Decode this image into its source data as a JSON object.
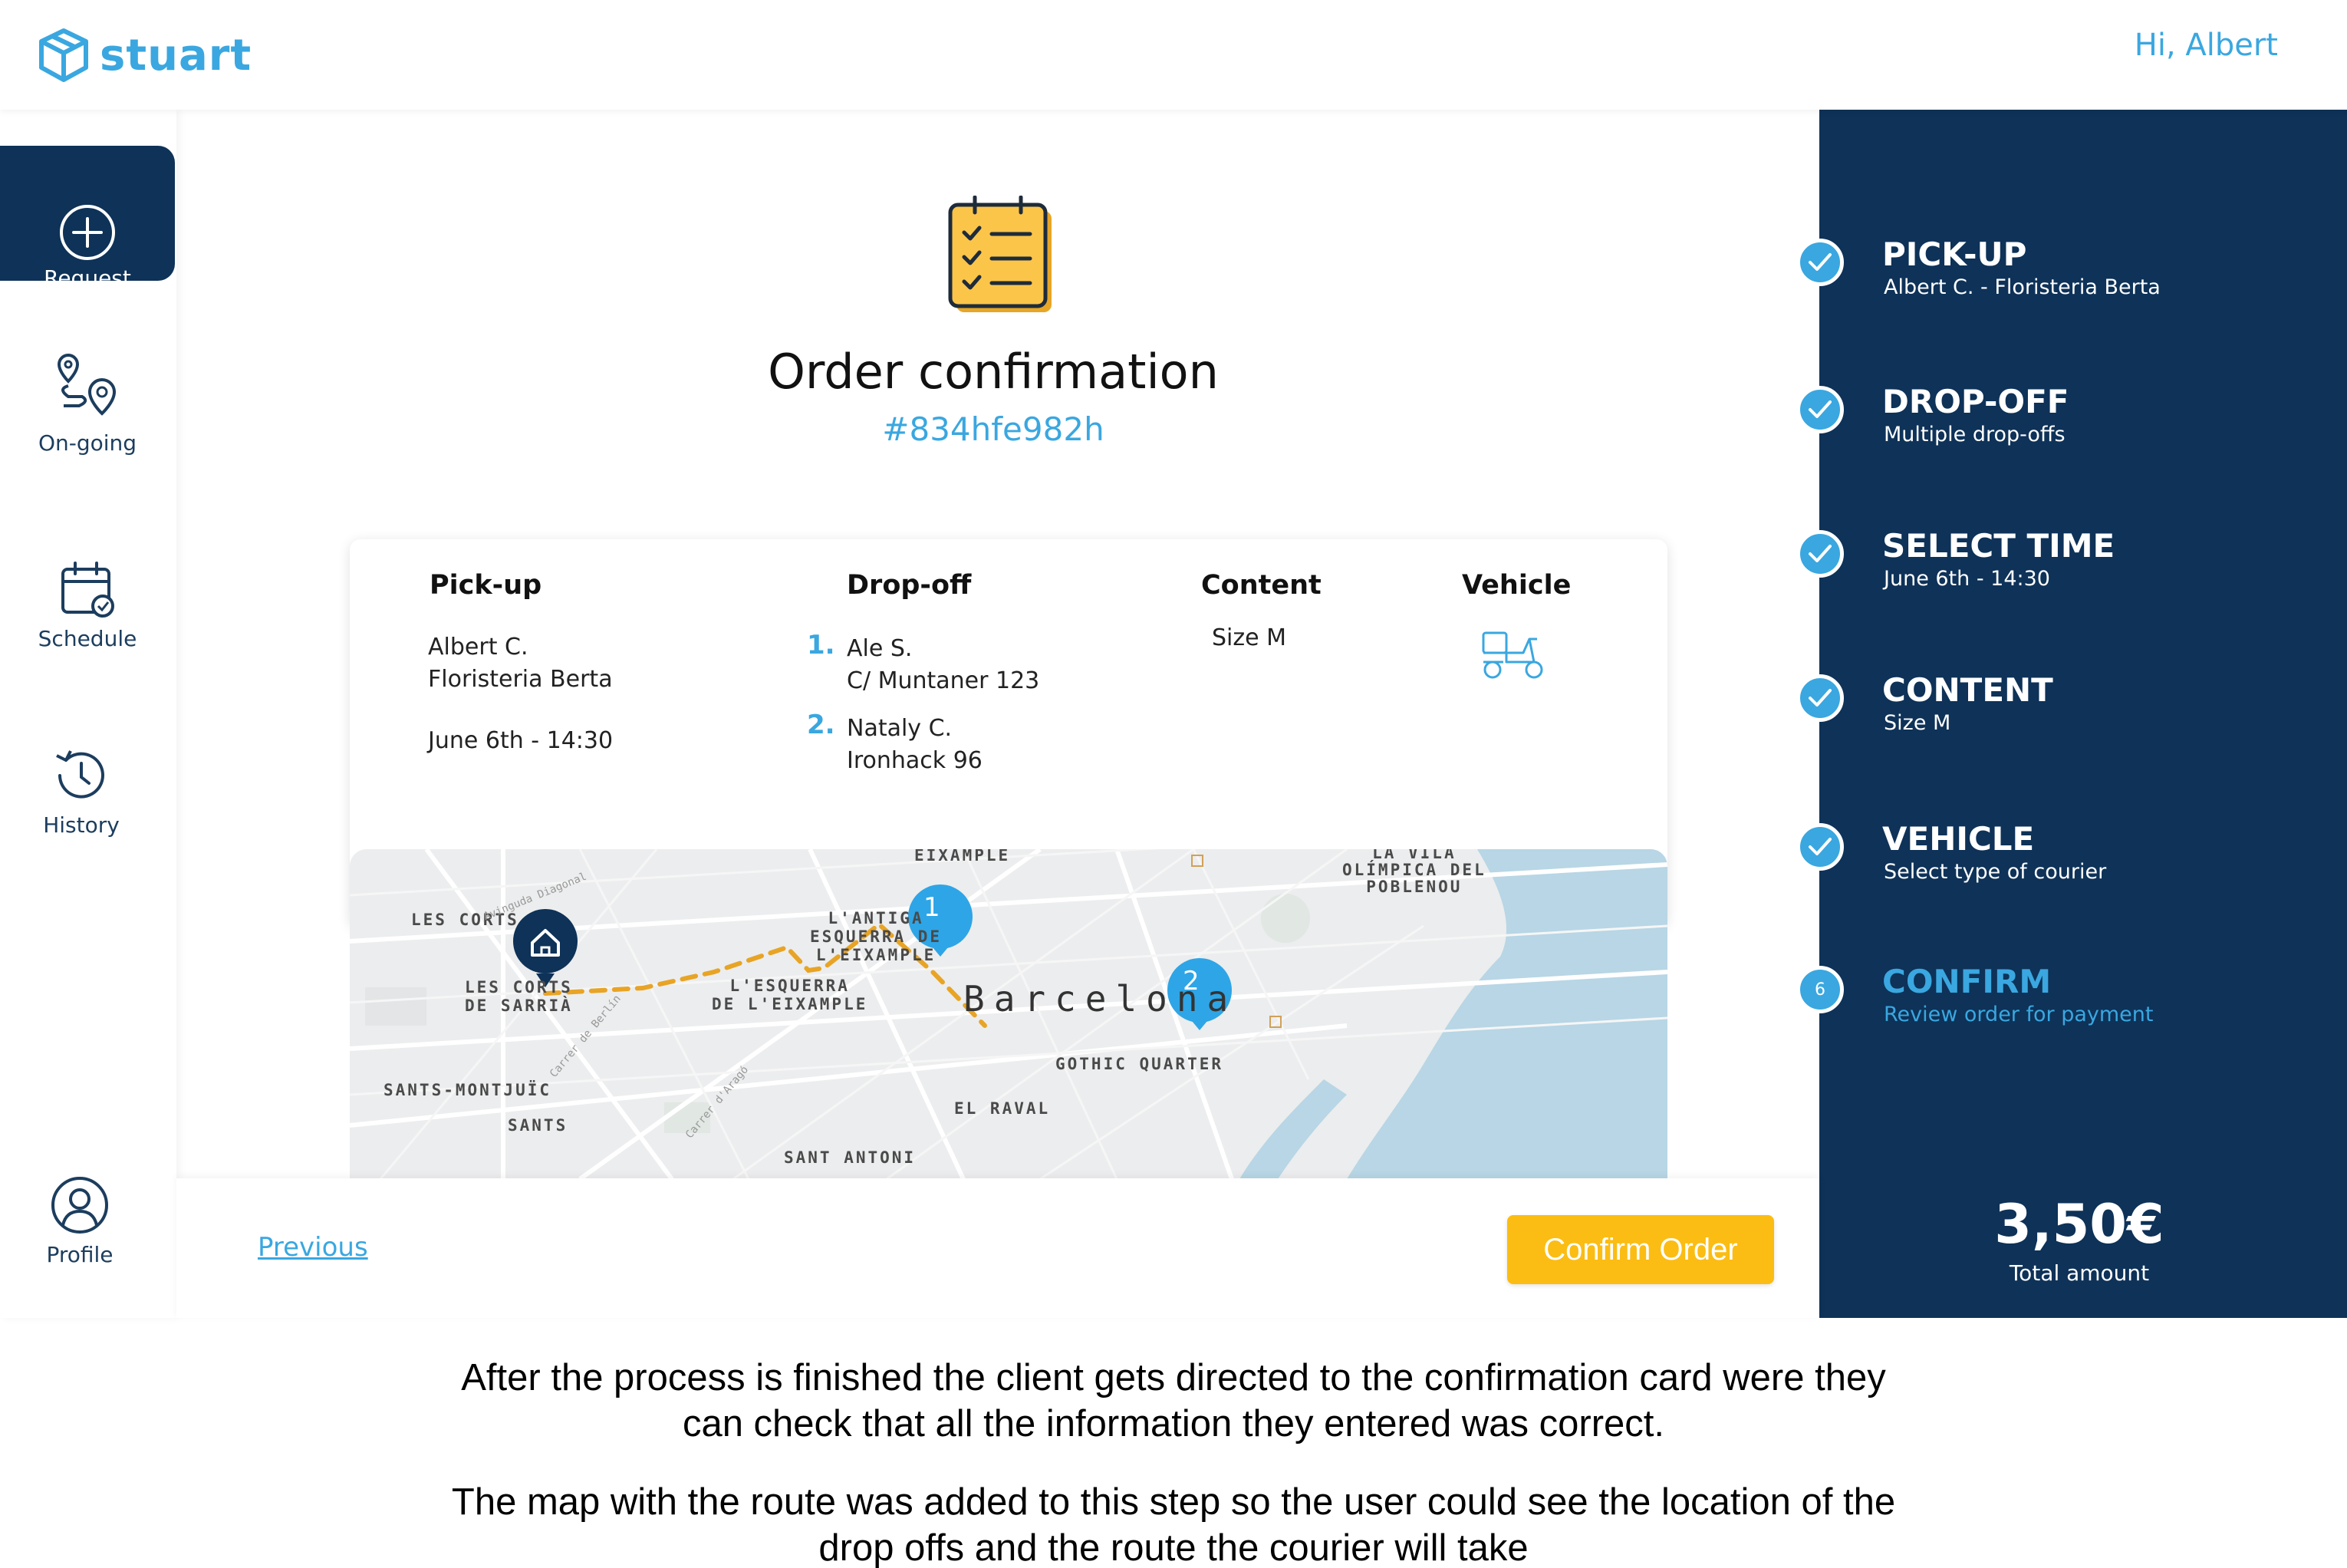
{
  "header": {
    "brand": "stuart",
    "greeting": "Hi, Albert"
  },
  "nav": {
    "request": "Request",
    "ongoing": "On-going",
    "schedule": "Schedule",
    "history": "History",
    "profile": "Profile"
  },
  "order": {
    "title": "Order confirmation",
    "id": "#834hfe982h",
    "headers": {
      "pickup": "Pick-up",
      "dropoff": "Drop-off",
      "content": "Content",
      "vehicle": "Vehicle"
    },
    "pickup": {
      "name": "Albert C.",
      "place": "Floristeria Berta",
      "time": "June 6th - 14:30"
    },
    "dropoffs": [
      {
        "num": "1.",
        "name": "Ale S.",
        "address": "C/ Muntaner 123"
      },
      {
        "num": "2.",
        "name": "Nataly C.",
        "address": "Ironhack 96"
      }
    ],
    "content": "Size M",
    "vehicle_icon": "scooter-icon"
  },
  "map": {
    "labels": {
      "eixample": "EIXAMPLE",
      "vila_olimpica": "LA VILA\nOLÍMPICA DEL\nPOBLENOU",
      "les_corts_top": "LES CORTS",
      "antiga_esquerra": "L'ANTIGA\nESQUERRA DE\nL'EIXAMPLE",
      "les_corts_sarria": "LES CORTS\nDE SARRIÀ",
      "nova_esquerra": "L'ESQUERRA\nDE L'EIXAMPLE",
      "city": "Barcelona",
      "gothic": "GOTHIC QUARTER",
      "sants_montjuic": "SANTS-MONTJUÏC",
      "sants": "SANTS",
      "raval": "EL RAVAL",
      "sant_antoni": "SANT ANTONI",
      "avinguda": "Avinguda Diagonal",
      "carrer_berlin": "Carrer de Berlín",
      "carrer_arago": "Carrer d'Aragó"
    },
    "marker_1": "1",
    "marker_2": "2"
  },
  "footer": {
    "previous": "Previous",
    "confirm": "Confirm Order"
  },
  "steps": [
    {
      "title": "PICK-UP",
      "sub": "Albert C. - Floristeria Berta",
      "state": "done"
    },
    {
      "title": "DROP-OFF",
      "sub": "Multiple drop-offs",
      "state": "done"
    },
    {
      "title": "SELECT TIME",
      "sub": "June 6th - 14:30",
      "state": "done"
    },
    {
      "title": "CONTENT",
      "sub": "Size M",
      "state": "done"
    },
    {
      "title": "VEHICLE",
      "sub": "Select type of courier",
      "state": "done"
    },
    {
      "title": "CONFIRM",
      "sub": "Review order for payment",
      "state": "current",
      "num": "6"
    }
  ],
  "total": {
    "amount": "3,50€",
    "label": "Total amount"
  },
  "caption": {
    "p1_line1": "After the process is finished the client gets directed to the confirmation card were they",
    "p1_line2": "can check that all the information they entered was correct.",
    "p2_line1": "The map with the route was added to this step so the user could see the location of the",
    "p2_line2": "drop offs and the route the courier will take"
  },
  "colors": {
    "brand": "#3aa7e0",
    "navy": "#0e3258",
    "accent": "#fbbd13",
    "route": "#e8a425"
  }
}
